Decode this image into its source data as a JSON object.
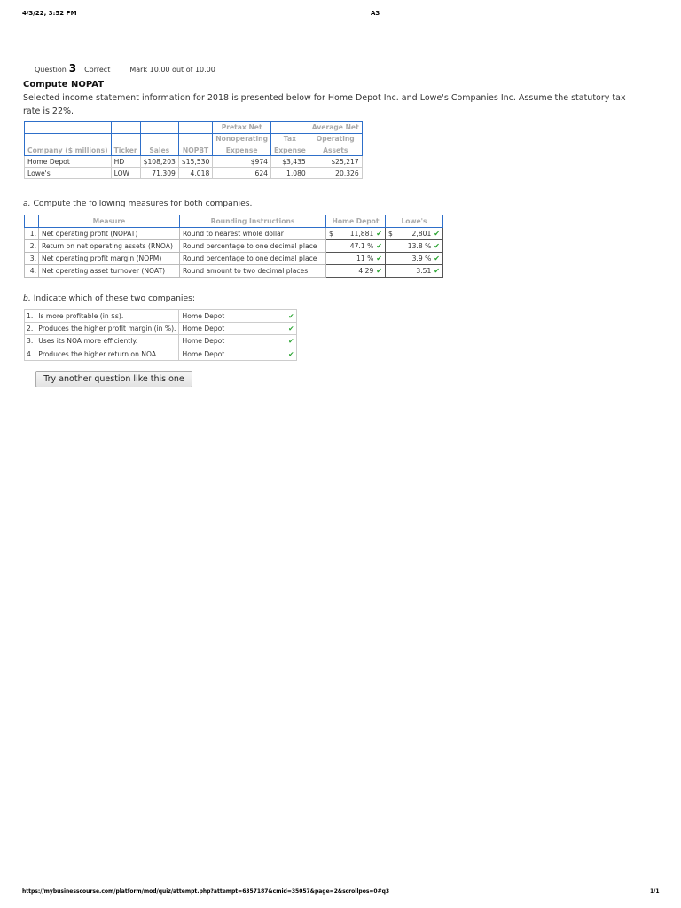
{
  "print_header": {
    "datetime": "4/3/22, 3:52 PM",
    "page_title": "A3"
  },
  "question_info": {
    "label": "Question",
    "number": "3",
    "state": "Correct",
    "grade": "Mark 10.00 out of 10.00"
  },
  "title": "Compute NOPAT",
  "prompt": "Selected income statement information for 2018 is presented below for Home Depot Inc. and Lowe's Companies Inc. Assume the statutory tax rate is 22%.",
  "data_table": {
    "headers": {
      "company": "Company ($ millions)",
      "ticker": "Ticker",
      "sales": "Sales",
      "nopbt": "NOPBT",
      "nonop_1": "Pretax Net",
      "nonop_2": "Nonoperating",
      "nonop_3": "Expense",
      "tax_1": "Tax",
      "tax_2": "Expense",
      "assets_1": "Average Net",
      "assets_2": "Operating",
      "assets_3": "Assets"
    },
    "rows": [
      {
        "company": "Home Depot",
        "ticker": "HD",
        "sales": "$108,203",
        "nopbt": "$15,530",
        "nonop": "$974",
        "tax": "$3,435",
        "assets": "$25,217"
      },
      {
        "company": "Lowe's",
        "ticker": "LOW",
        "sales": "71,309",
        "nopbt": "4,018",
        "nonop": "624",
        "tax": "1,080",
        "assets": "20,326"
      }
    ]
  },
  "part_a": {
    "label": "a.",
    "text": "Compute the following measures for both companies.",
    "headers": {
      "measure": "Measure",
      "rounding": "Rounding Instructions",
      "hd": "Home Depot",
      "low": "Lowe's"
    },
    "rows": [
      {
        "num": "1.",
        "measure": "Net operating profit (NOPAT)",
        "rounding": "Round to nearest whole dollar",
        "hd_prefix": "$",
        "hd": "11,881",
        "low_prefix": "$",
        "low": "2,801"
      },
      {
        "num": "2.",
        "measure": "Return on net operating assets (RNOA)",
        "rounding": "Round percentage to one decimal place",
        "hd_prefix": "",
        "hd": "47.1 %",
        "low_prefix": "",
        "low": "13.8 %"
      },
      {
        "num": "3.",
        "measure": "Net operating profit margin (NOPM)",
        "rounding": "Round percentage to one decimal place",
        "hd_prefix": "",
        "hd": "11 %",
        "low_prefix": "",
        "low": "3.9 %"
      },
      {
        "num": "4.",
        "measure": "Net operating asset turnover (NOAT)",
        "rounding": "Round amount to two decimal places",
        "hd_prefix": "",
        "hd": "4.29",
        "low_prefix": "",
        "low": "3.51"
      }
    ],
    "check": "✔"
  },
  "part_b": {
    "label": "b.",
    "text": "Indicate which of these two companies:",
    "rows": [
      {
        "num": "1.",
        "question": "Is more profitable (in $s).",
        "answer": "Home Depot"
      },
      {
        "num": "2.",
        "question": "Produces the higher profit margin (in %).",
        "answer": "Home Depot"
      },
      {
        "num": "3.",
        "question": "Uses its NOA more efficiently.",
        "answer": "Home Depot"
      },
      {
        "num": "4.",
        "question": "Produces the higher return on NOA.",
        "answer": "Home Depot"
      }
    ],
    "check": "✔"
  },
  "try_button": "Try another question like this one",
  "print_footer": {
    "url": "https://mybusinesscourse.com/platform/mod/quiz/attempt.php?attempt=6357187&cmid=35057&page=2&scrollpos=0#q3",
    "page": "1/1"
  },
  "colors": {
    "header_border": "#2e6fc9",
    "check_green": "#27a22e",
    "header_text": "#a9a9a9"
  }
}
